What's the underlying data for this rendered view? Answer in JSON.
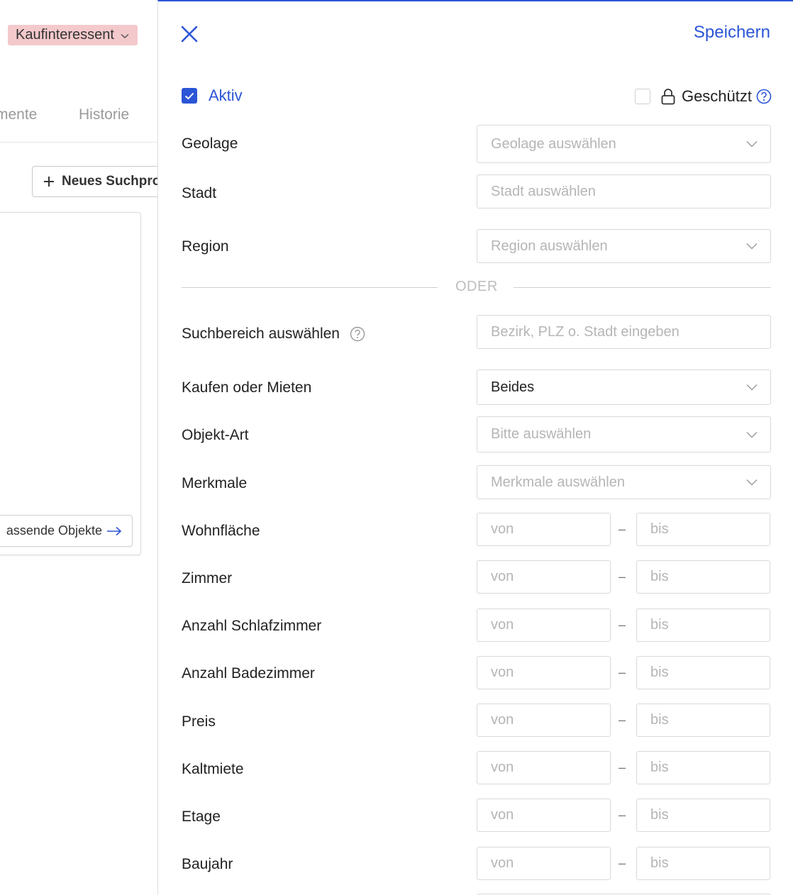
{
  "background": {
    "status_badge": "Kaufinteressent",
    "tabs": [
      "mente",
      "Historie"
    ],
    "new_search_button": "Neues Suchpro",
    "matching_objects_button": "assende Objekte"
  },
  "panel": {
    "save_label": "Speichern",
    "aktiv_label": "Aktiv",
    "protected_label": "Geschützt",
    "divider_label": "ODER",
    "fields": {
      "geolage": {
        "label": "Geolage",
        "placeholder": "Geolage auswählen"
      },
      "stadt": {
        "label": "Stadt",
        "placeholder": "Stadt auswählen"
      },
      "region": {
        "label": "Region",
        "placeholder": "Region auswählen"
      },
      "suchbereich": {
        "label": "Suchbereich auswählen",
        "placeholder": "Bezirk, PLZ o. Stadt eingeben"
      },
      "kaufen_mieten": {
        "label": "Kaufen oder Mieten",
        "value": "Beides"
      },
      "objekt_art": {
        "label": "Objekt-Art",
        "placeholder": "Bitte auswählen"
      },
      "merkmale": {
        "label": "Merkmale",
        "placeholder": "Merkmale auswählen"
      }
    },
    "range_separator": "–",
    "range_from_placeholder": "von",
    "range_to_placeholder": "bis",
    "ranges": [
      {
        "label": "Wohnfläche"
      },
      {
        "label": "Zimmer"
      },
      {
        "label": "Anzahl Schlafzimmer"
      },
      {
        "label": "Anzahl Badezimmer"
      },
      {
        "label": "Preis"
      },
      {
        "label": "Kaltmiete"
      },
      {
        "label": "Etage"
      },
      {
        "label": "Baujahr"
      }
    ]
  },
  "colors": {
    "accent": "#2b55d6",
    "badge_bg": "#f4c9cc",
    "placeholder": "#b5b5b5"
  }
}
